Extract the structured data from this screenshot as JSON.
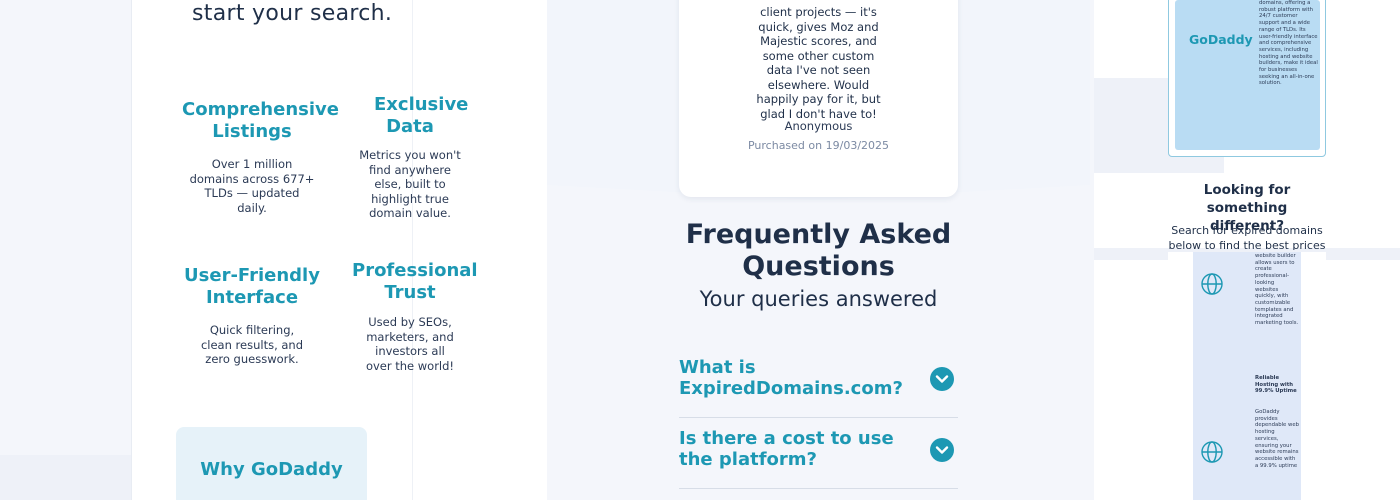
{
  "left": {
    "intro_tail": "start your search.",
    "features": [
      {
        "title": "Comprehensive Listings",
        "desc": "Over 1 million domains across 677+ TLDs — updated daily."
      },
      {
        "title": "Exclusive Data",
        "desc": "Metrics you won't find anywhere else, built to highlight true domain value."
      },
      {
        "title": "User-Friendly Interface",
        "desc": "Quick filtering, clean results, and zero guesswork."
      },
      {
        "title": "Professional Trust",
        "desc": "Used by SEOs, marketers, and investors all over the world!"
      }
    ],
    "why_title": "Why GoDaddy"
  },
  "review": {
    "text": "client projects — it's quick, gives Moz and Majestic scores, and some other custom data I've not seen elsewhere. Would happily pay for it, but glad I don't have to!",
    "author": "Anonymous",
    "date": "Purchased on 19/03/2025"
  },
  "faq": {
    "title": "Frequently Asked Questions",
    "subtitle": "Your queries answered",
    "items": [
      {
        "question": "What is ExpiredDomains.com?"
      },
      {
        "question": "Is there a cost to use the platform?"
      }
    ]
  },
  "right": {
    "godaddy_logo": "GoDaddy",
    "godaddy_blurb": "domains, offering a robust platform with 24/7 customer support and a wide range of TLDs. Its user-friendly interface and comprehensive services, including hosting and website builders, make it ideal for businesses seeking an all-in-one solution.",
    "looking_title": "Looking for something different?",
    "looking_desc": "Search for expired domains below to find the best prices",
    "blurb_1": "website builder allows users to create professional-looking websites quickly, with customizable templates and integrated marketing tools.",
    "blurb_2_heading": "Reliable Hosting with 99.9% Uptime",
    "blurb_2": "GoDaddy provides dependable web hosting services, ensuring your website remains accessible with a 99.9% uptime"
  },
  "colors": {
    "accent": "#1d98b3",
    "text": "#1f2f48",
    "muted": "#7c8aa3"
  },
  "icons": {
    "faq_toggle": "chevron-down-icon",
    "feature": "globe-icon"
  }
}
